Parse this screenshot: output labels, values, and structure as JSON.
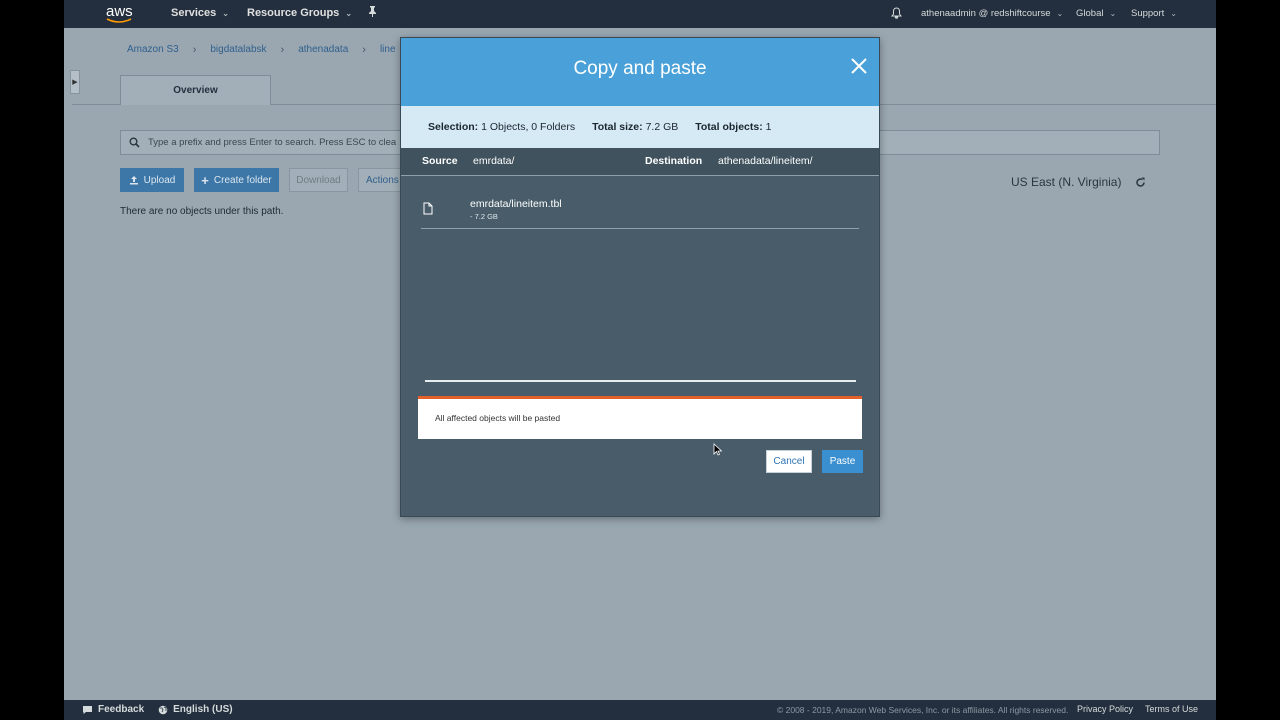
{
  "topnav": {
    "logo": "aws",
    "services": "Services",
    "resource_groups": "Resource Groups",
    "account": "athenaadmin @ redshiftcourse",
    "region": "Global",
    "support": "Support",
    "icons": [
      "pin-icon",
      "bell-icon"
    ]
  },
  "breadcrumb": [
    "Amazon S3",
    "bigdatalabsk",
    "athenadata",
    "line"
  ],
  "tabs": {
    "overview": "Overview"
  },
  "search": {
    "placeholder": "Type a prefix and press Enter to search. Press ESC to clea"
  },
  "toolbar": {
    "upload": "Upload",
    "create_folder": "Create folder",
    "download": "Download",
    "actions": "Actions"
  },
  "empty_message": "There are no objects under this path.",
  "region_label": "US East (N. Virginia)",
  "modal": {
    "title": "Copy and paste",
    "summary": {
      "selection_label": "Selection:",
      "selection_value": "1 Objects, 0 Folders",
      "size_label": "Total size:",
      "size_value": "7.2 GB",
      "objects_label": "Total objects:",
      "objects_value": "1"
    },
    "source_label": "Source",
    "source_value": "emrdata/",
    "destination_label": "Destination",
    "destination_value": "athenadata/lineitem/",
    "files": [
      {
        "name": "emrdata/lineitem.tbl",
        "size": "- 7.2 GB"
      }
    ],
    "notice": "All affected objects will be pasted",
    "cancel": "Cancel",
    "paste": "Paste"
  },
  "footer": {
    "feedback": "Feedback",
    "language": "English (US)",
    "copyright": "© 2008 - 2019, Amazon Web Services, Inc. or its affiliates. All rights reserved.",
    "privacy": "Privacy Policy",
    "terms": "Terms of Use"
  },
  "colors": {
    "nav_bg": "#232f3e",
    "modal_header": "#4aa0d8",
    "modal_body": "#485d69",
    "primary_button": "#3a8fd0",
    "notice_accent": "#e4612a"
  }
}
